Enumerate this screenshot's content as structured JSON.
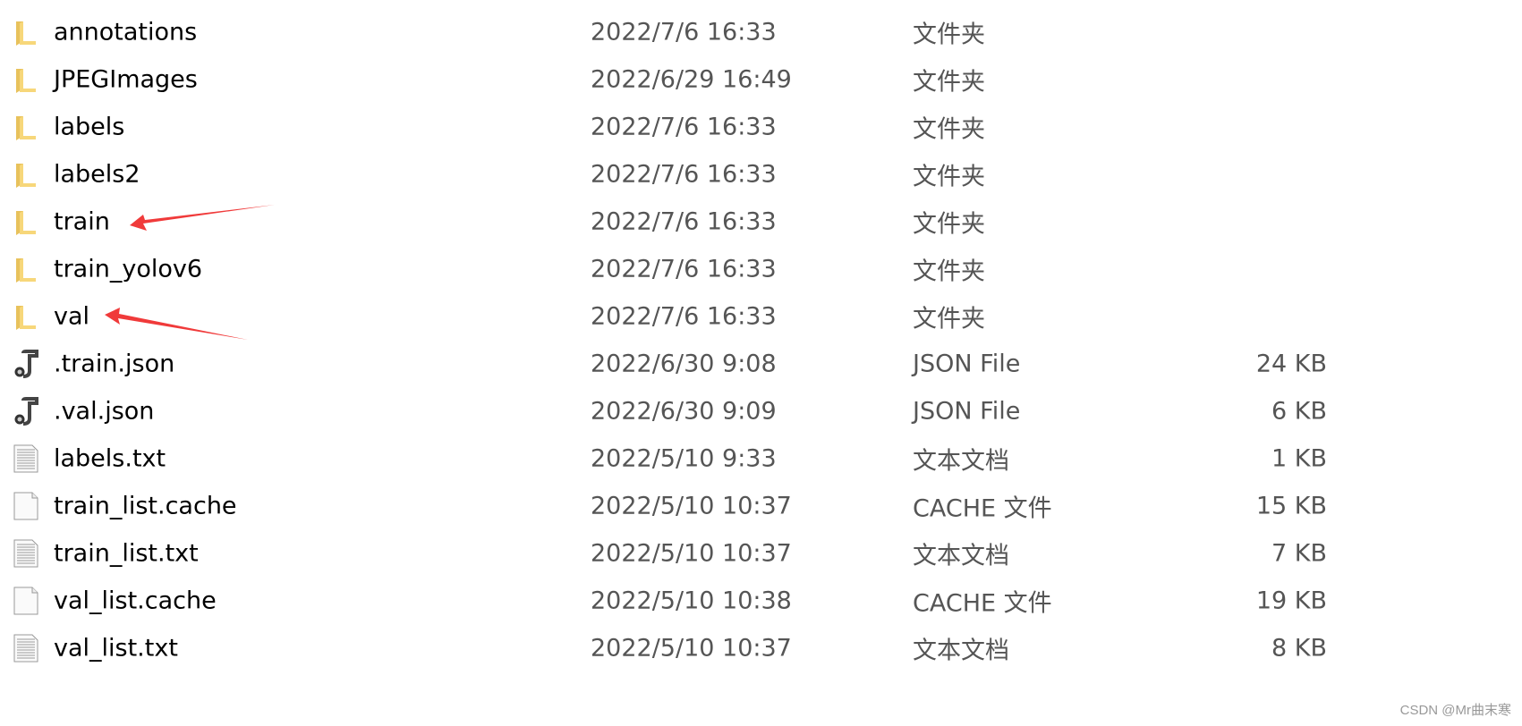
{
  "files": [
    {
      "name": "annotations",
      "date": "2022/7/6 16:33",
      "type": "文件夹",
      "size": "",
      "icon": "folder-icon"
    },
    {
      "name": "JPEGImages",
      "date": "2022/6/29 16:49",
      "type": "文件夹",
      "size": "",
      "icon": "folder-icon"
    },
    {
      "name": "labels",
      "date": "2022/7/6 16:33",
      "type": "文件夹",
      "size": "",
      "icon": "folder-icon"
    },
    {
      "name": "labels2",
      "date": "2022/7/6 16:33",
      "type": "文件夹",
      "size": "",
      "icon": "folder-icon"
    },
    {
      "name": "train",
      "date": "2022/7/6 16:33",
      "type": "文件夹",
      "size": "",
      "icon": "folder-icon"
    },
    {
      "name": "train_yolov6",
      "date": "2022/7/6 16:33",
      "type": "文件夹",
      "size": "",
      "icon": "folder-icon"
    },
    {
      "name": "val",
      "date": "2022/7/6 16:33",
      "type": "文件夹",
      "size": "",
      "icon": "folder-icon"
    },
    {
      "name": ".train.json",
      "date": "2022/6/30 9:08",
      "type": "JSON File",
      "size": "24 KB",
      "icon": "json-file-icon"
    },
    {
      "name": ".val.json",
      "date": "2022/6/30 9:09",
      "type": "JSON File",
      "size": "6 KB",
      "icon": "json-file-icon"
    },
    {
      "name": "labels.txt",
      "date": "2022/5/10 9:33",
      "type": "文本文档",
      "size": "1 KB",
      "icon": "text-file-icon"
    },
    {
      "name": "train_list.cache",
      "date": "2022/5/10 10:37",
      "type": "CACHE 文件",
      "size": "15 KB",
      "icon": "blank-file-icon"
    },
    {
      "name": "train_list.txt",
      "date": "2022/5/10 10:37",
      "type": "文本文档",
      "size": "7 KB",
      "icon": "text-file-icon"
    },
    {
      "name": "val_list.cache",
      "date": "2022/5/10 10:38",
      "type": "CACHE 文件",
      "size": "19 KB",
      "icon": "blank-file-icon"
    },
    {
      "name": "val_list.txt",
      "date": "2022/5/10 10:37",
      "type": "文本文档",
      "size": "8 KB",
      "icon": "text-file-icon"
    }
  ],
  "annotation_color": "#f03a3a",
  "watermark": "CSDN @Mr曲末寒"
}
